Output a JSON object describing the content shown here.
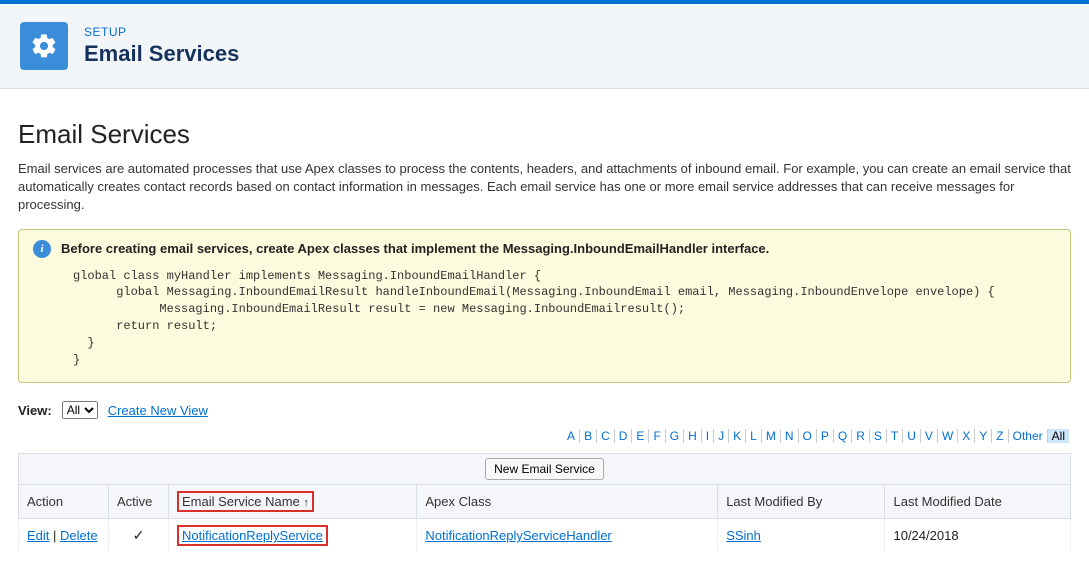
{
  "header": {
    "eyebrow": "SETUP",
    "title": "Email Services"
  },
  "page": {
    "title": "Email Services",
    "description": "Email services are automated processes that use Apex classes to process the contents, headers, and attachments of inbound email. For example, you can create an email service that automatically creates contact records based on contact information in messages. Each email service has one or more email service addresses that can receive messages for processing."
  },
  "info": {
    "heading": "Before creating email services, create Apex classes that implement the Messaging.InboundEmailHandler interface.",
    "code": "global class myHandler implements Messaging.InboundEmailHandler {\n      global Messaging.InboundEmailResult handleInboundEmail(Messaging.InboundEmail email, Messaging.InboundEnvelope envelope) {\n            Messaging.InboundEmailResult result = new Messaging.InboundEmailresult();\n      return result;\n  }\n}"
  },
  "view": {
    "label": "View:",
    "selected": "All",
    "create_link": "Create New View"
  },
  "alpha": {
    "letters": [
      "A",
      "B",
      "C",
      "D",
      "E",
      "F",
      "G",
      "H",
      "I",
      "J",
      "K",
      "L",
      "M",
      "N",
      "O",
      "P",
      "Q",
      "R",
      "S",
      "T",
      "U",
      "V",
      "W",
      "X",
      "Y",
      "Z"
    ],
    "other": "Other",
    "all": "All"
  },
  "table": {
    "new_button": "New Email Service",
    "columns": {
      "action": "Action",
      "active": "Active",
      "name": "Email Service Name",
      "apex": "Apex Class",
      "modified_by": "Last Modified By",
      "modified_date": "Last Modified Date"
    },
    "rows": [
      {
        "edit": "Edit",
        "del": "Delete",
        "active": "✓",
        "name": "NotificationReplyService",
        "apex": "NotificationReplyServiceHandler",
        "modified_by": "SSinh",
        "modified_date": "10/24/2018"
      }
    ]
  }
}
